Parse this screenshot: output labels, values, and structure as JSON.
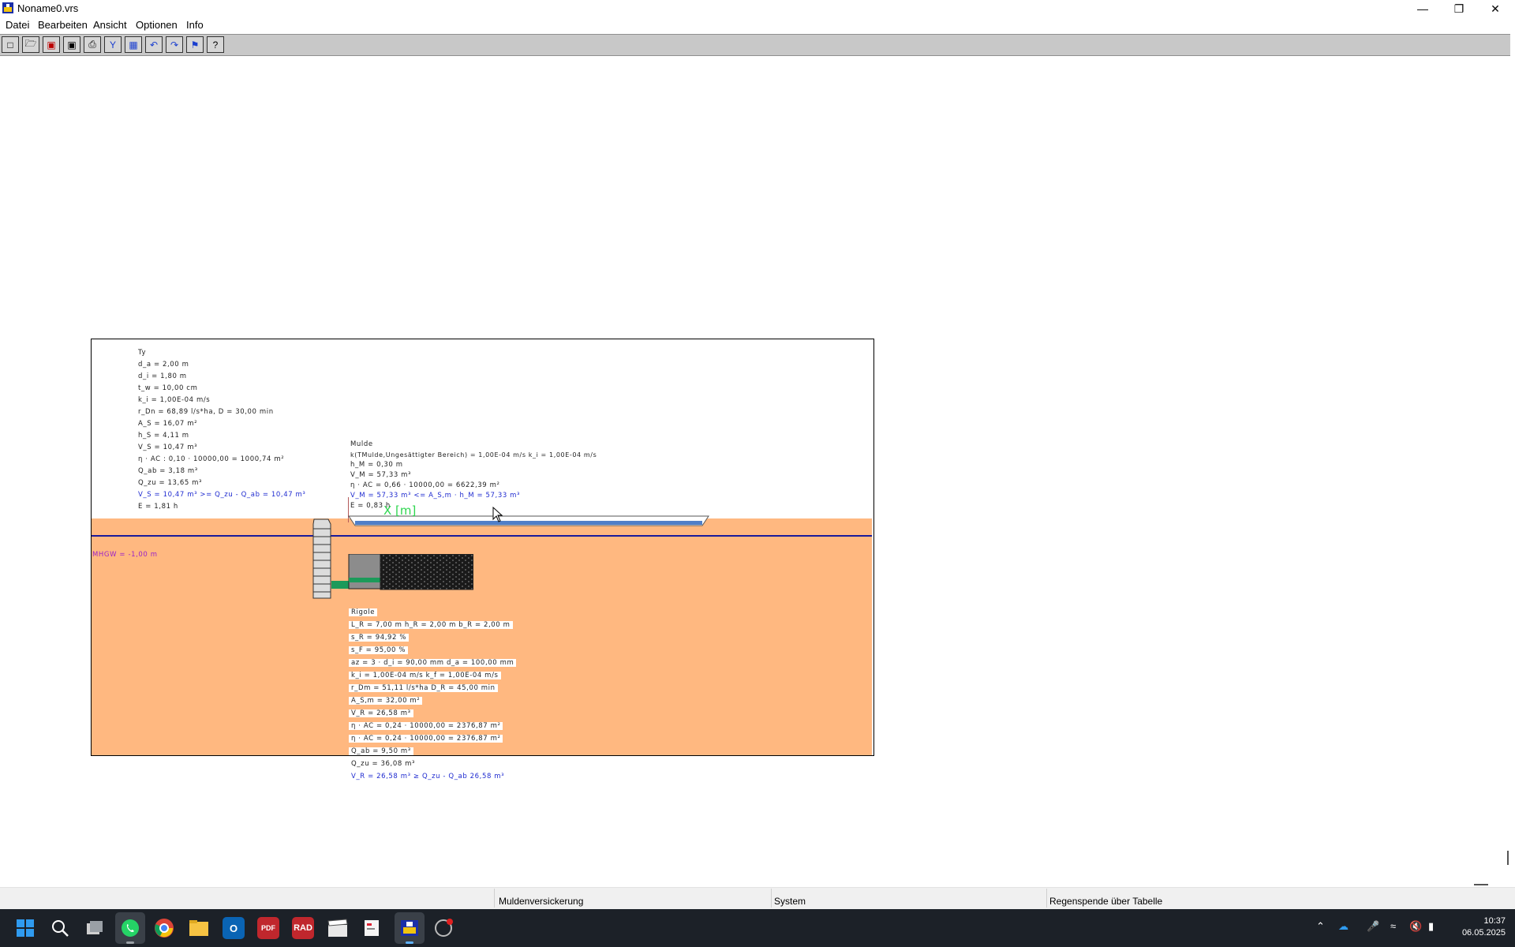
{
  "window": {
    "title": "Noname0.vrs"
  },
  "menu": {
    "items": [
      "Datei",
      "Bearbeiten",
      "Ansicht",
      "Optionen",
      "Info"
    ]
  },
  "drawing": {
    "schacht_lines": [
      "Ty",
      "d_a = 2,00 m",
      "d_i = 1,80 m",
      "t_w = 10,00 cm",
      "k_i = 1,00E-04 m/s",
      "r_Dn = 68,89 l/s*ha, D = 30,00 min",
      "A_S = 16,07 m²",
      "h_S = 4,11 m",
      "V_S = 10,47 m³",
      "η · AC : 0,10 · 10000,00 = 1000,74 m²",
      "Q_ab = 3,18 m³",
      "Q_zu = 13,65 m³",
      "V_S = 10,47 m³ >= Q_zu - Q_ab = 10,47 m³",
      "E = 1,81 h"
    ],
    "mulde_lines": [
      "Mulde",
      "k(TMulde,Ungesättigter Bereich) = 1,00E-04 m/s k_i = 1,00E-04 m/s",
      "h_M = 0,30 m",
      "V_M = 57,33 m³",
      "η · AC = 0,66 · 10000,00 = 6622,39 m²",
      "V_M = 57,33 m³ <= A_S,m · h_M = 57,33 m³",
      "E = 0,83 h"
    ],
    "x_axis_label": "X [m]",
    "mhgw_label": "MHGW = -1,00 m",
    "rigole_lines": [
      "Rigole",
      "L_R = 7,00 m h_R = 2,00 m b_R = 2,00 m",
      "s_R = 94,92 %",
      "s_F = 95,00 %",
      "az = 3 · d_i = 90,00 mm d_a = 100,00 mm",
      "k_i = 1,00E-04 m/s k_f = 1,00E-04 m/s",
      "r_Dm = 51,11 l/s*ha D_R = 45,00 min",
      "A_S,m = 32,00 m²",
      "V_R = 26,58 m³",
      "η · AC = 0,24 · 10000,00 = 2376,87 m²",
      "η · AC = 0,24 · 10000,00 = 2376,87 m²",
      "Q_ab = 9,50 m³",
      "Q_zu = 36,08 m³",
      "V_R = 26,58 m³ ≥ Q_zu - Q_ab 26,58 m³"
    ]
  },
  "status": {
    "mode": "Muldenversickerung",
    "system": "System",
    "regen": "Regenspende über Tabelle"
  },
  "taskbar": {
    "pinned": [
      "start-icon",
      "search-icon",
      "task-view-icon",
      "whatsapp-icon",
      "chrome-icon",
      "file-explorer-icon",
      "outlook-icon",
      "pdf-editor-icon",
      "rad-icon",
      "clapper-icon",
      "snipping-tool-icon",
      "app-active-icon",
      "aperture-icon"
    ],
    "rad_label": "RAD",
    "pdf_label": "PDF",
    "time": "10:37",
    "date": "06.05.2025"
  },
  "colors": {
    "ground": "#ffb880",
    "groundwater_line": "#1a1a9a",
    "mulde_water": "#4f7fc8",
    "pipe": "#1c9a5a",
    "x_label": "#2ed64f",
    "taskbar": "#1c2128"
  }
}
